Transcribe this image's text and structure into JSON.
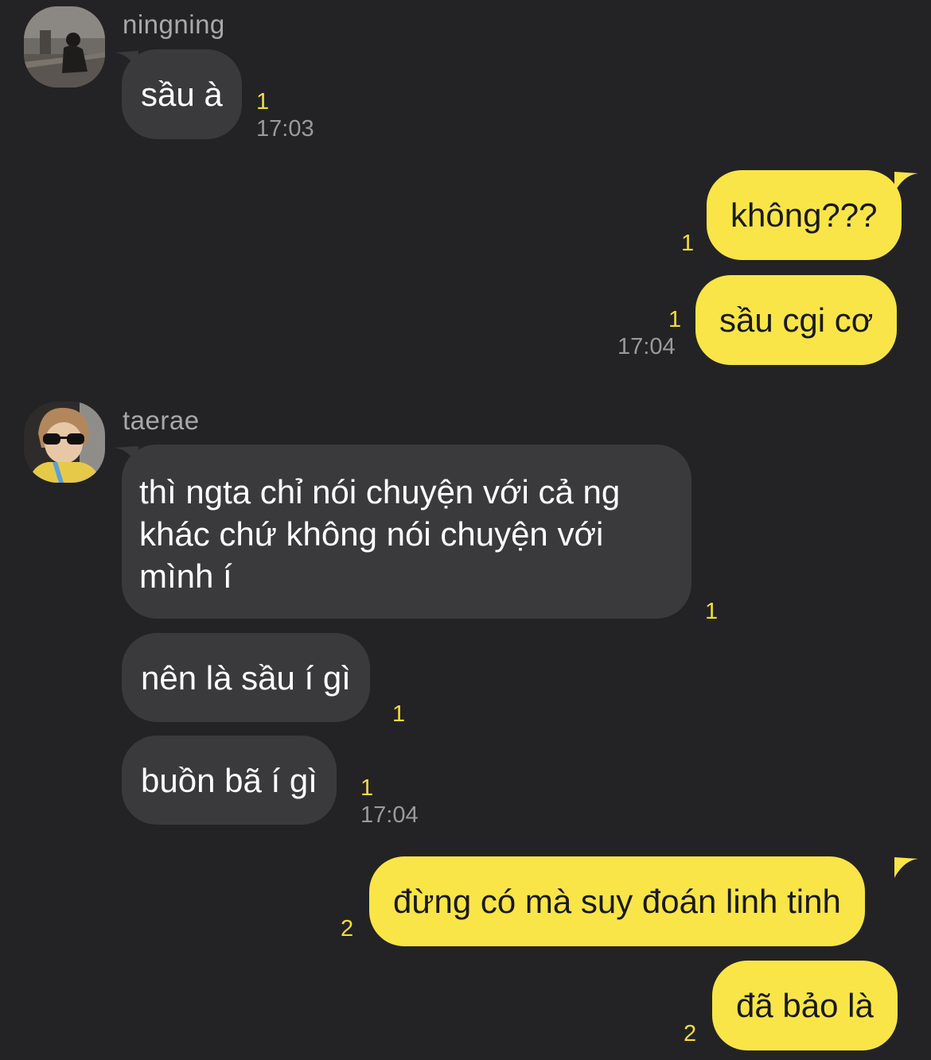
{
  "chat": {
    "messages": [
      {
        "sender": "ningning",
        "text": "sầu à",
        "unread": "1",
        "time": "17:03"
      },
      {
        "sender": "me",
        "text": "không???",
        "unread": "1"
      },
      {
        "sender": "me",
        "text": "sầu cgi cơ",
        "unread": "1",
        "time": "17:04"
      },
      {
        "sender": "taerae",
        "text": "thì ngta chỉ nói chuyện với cả ng khác chứ không nói chuyện với mình í",
        "unread": "1"
      },
      {
        "sender": "taerae",
        "text": "nên là sầu í gì",
        "unread": "1"
      },
      {
        "sender": "taerae",
        "text": "buồn bã í gì",
        "unread": "1",
        "time": "17:04"
      },
      {
        "sender": "me",
        "text": "đừng có mà suy đoán linh tinh",
        "unread": "2"
      },
      {
        "sender": "me",
        "text": "đã bảo là",
        "unread": "2"
      }
    ]
  },
  "senders": {
    "ningning": {
      "name": "ningning",
      "avatar_icon": "profile-photo-icon"
    },
    "taerae": {
      "name": "taerae",
      "avatar_icon": "profile-photo-icon"
    }
  },
  "colors": {
    "background": "#232325",
    "incoming_bubble": "#3a3a3c",
    "outgoing_bubble": "#f9e547",
    "unread_count": "#f4dc3a",
    "timestamp": "#9a9a9c"
  }
}
